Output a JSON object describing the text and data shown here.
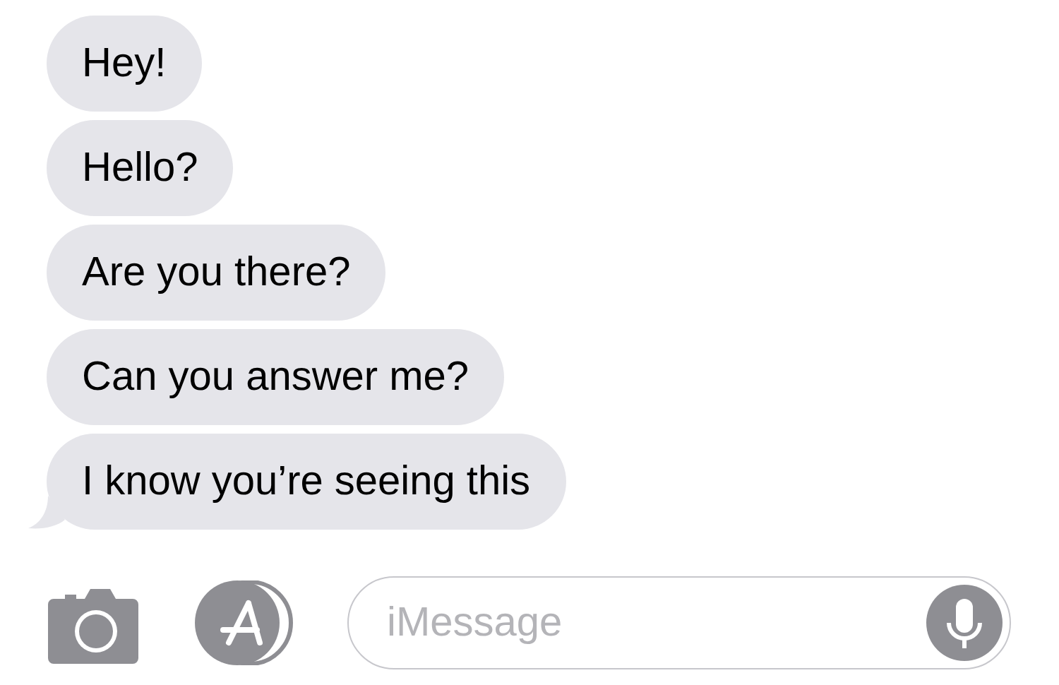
{
  "messages": [
    {
      "text": "Hey!",
      "tail": false
    },
    {
      "text": "Hello?",
      "tail": false
    },
    {
      "text": "Are you there?",
      "tail": false
    },
    {
      "text": "Can you answer me?",
      "tail": false
    },
    {
      "text": "I know you’re seeing this",
      "tail": true
    }
  ],
  "compose": {
    "placeholder": "iMessage"
  }
}
